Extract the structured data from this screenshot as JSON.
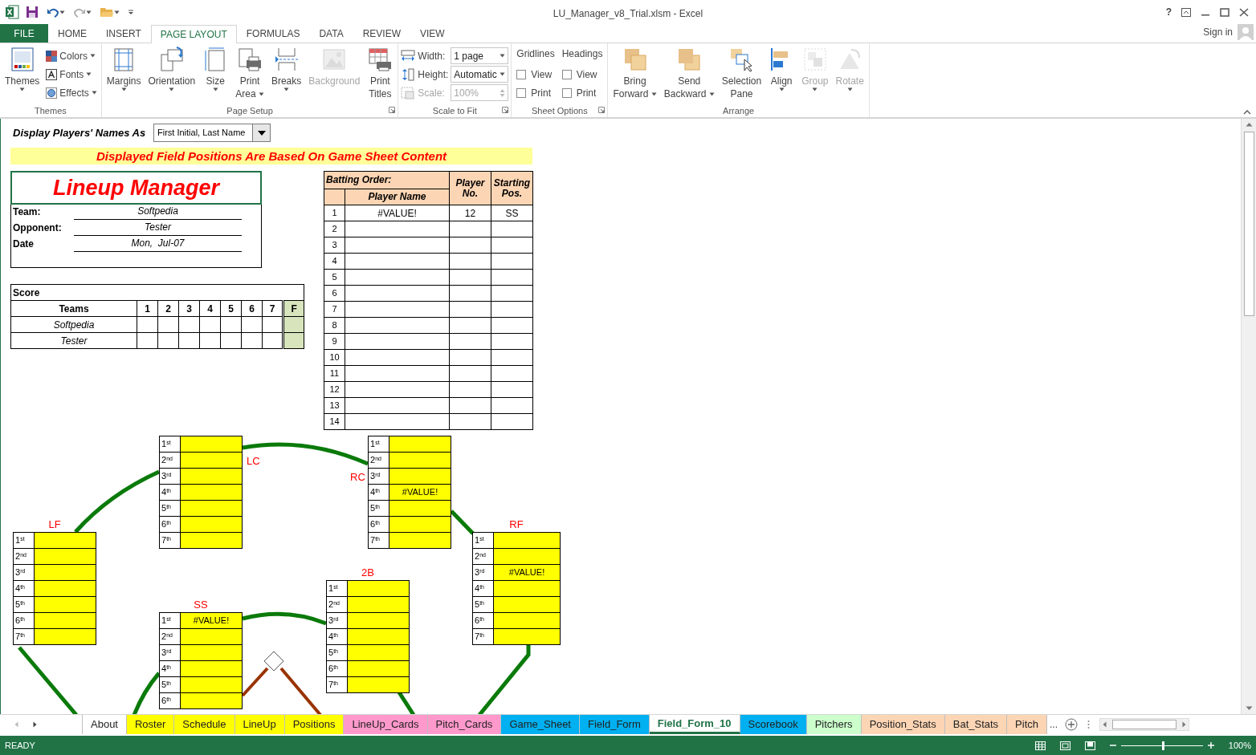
{
  "title_bar": {
    "title": "LU_Manager_v8_Trial.xlsm - Excel",
    "help": "?"
  },
  "ribbon_tabs": [
    {
      "label": "FILE",
      "kind": "file",
      "selected": false
    },
    {
      "label": "HOME",
      "kind": "tab",
      "selected": false
    },
    {
      "label": "INSERT",
      "kind": "tab",
      "selected": false
    },
    {
      "label": "PAGE LAYOUT",
      "kind": "tab",
      "selected": true
    },
    {
      "label": "FORMULAS",
      "kind": "tab",
      "selected": false
    },
    {
      "label": "DATA",
      "kind": "tab",
      "selected": false
    },
    {
      "label": "REVIEW",
      "kind": "tab",
      "selected": false
    },
    {
      "label": "VIEW",
      "kind": "tab",
      "selected": false
    }
  ],
  "account": {
    "label": "Sign in"
  },
  "ribbon_groups": [
    {
      "title": "Themes",
      "launcher": false,
      "items": [
        {
          "kind": "large",
          "lines": [
            "Themes"
          ],
          "dropdown": true,
          "disabled": false
        },
        {
          "kind": "small",
          "label": "Colors",
          "dropdown": true,
          "disabled": false
        },
        {
          "kind": "small",
          "label": "Fonts",
          "dropdown": true,
          "disabled": false
        },
        {
          "kind": "small",
          "label": "Effects",
          "dropdown": true,
          "disabled": false
        }
      ]
    },
    {
      "title": "Page Setup",
      "launcher": true,
      "items": [
        {
          "kind": "large",
          "lines": [
            "Margins"
          ],
          "dropdown": true,
          "disabled": false
        },
        {
          "kind": "large",
          "lines": [
            "Orientation"
          ],
          "dropdown": true,
          "disabled": false
        },
        {
          "kind": "large",
          "lines": [
            "Size"
          ],
          "dropdown": true,
          "disabled": false
        },
        {
          "kind": "large",
          "lines": [
            "Print",
            "Area"
          ],
          "dropdown": true,
          "disabled": false
        },
        {
          "kind": "large",
          "lines": [
            "Breaks"
          ],
          "dropdown": true,
          "disabled": false
        },
        {
          "kind": "large",
          "lines": [
            "Background"
          ],
          "dropdown": false,
          "disabled": true
        },
        {
          "kind": "large",
          "lines": [
            "Print",
            "Titles"
          ],
          "dropdown": false,
          "disabled": false
        }
      ]
    },
    {
      "title": "Scale to Fit",
      "launcher": true,
      "items": [
        {
          "kind": "field",
          "label": "Width:",
          "value": "1 page",
          "disabled": false
        },
        {
          "kind": "field",
          "label": "Height:",
          "value": "Automatic",
          "disabled": false
        },
        {
          "kind": "spin",
          "label": "Scale:",
          "value": "100%",
          "disabled": true
        }
      ]
    },
    {
      "title": "Sheet Options",
      "launcher": true,
      "items": [
        {
          "kind": "checks",
          "heading": "Gridlines",
          "options": [
            {
              "label": "View",
              "checked": false
            },
            {
              "label": "Print",
              "checked": false
            }
          ]
        },
        {
          "kind": "checks",
          "heading": "Headings",
          "options": [
            {
              "label": "View",
              "checked": false
            },
            {
              "label": "Print",
              "checked": false
            }
          ]
        }
      ]
    },
    {
      "title": "Arrange",
      "launcher": false,
      "items": [
        {
          "kind": "large",
          "lines": [
            "Bring",
            "Forward"
          ],
          "dropdown": true,
          "disabled": false
        },
        {
          "kind": "large",
          "lines": [
            "Send",
            "Backward"
          ],
          "dropdown": true,
          "disabled": false
        },
        {
          "kind": "large",
          "lines": [
            "Selection",
            "Pane"
          ],
          "dropdown": false,
          "disabled": false
        },
        {
          "kind": "large",
          "lines": [
            "Align"
          ],
          "dropdown": true,
          "disabled": false
        },
        {
          "kind": "large",
          "lines": [
            "Group"
          ],
          "dropdown": true,
          "disabled": true
        },
        {
          "kind": "large",
          "lines": [
            "Rotate"
          ],
          "dropdown": true,
          "disabled": true
        }
      ]
    }
  ],
  "names_as": {
    "label": "Display Players' Names As",
    "value": "First Initial, Last Name"
  },
  "banner": "Displayed Field Positions Are Based On Game Sheet Content",
  "lineup": {
    "title": "Lineup Manager",
    "fields": [
      {
        "label": "Team:",
        "value": "Softpedia"
      },
      {
        "label": "Opponent:",
        "value": "Tester"
      },
      {
        "label": "Date",
        "value": "Mon,  Jul-07"
      }
    ]
  },
  "score": {
    "title": "Score",
    "columns": [
      "Teams",
      "1",
      "2",
      "3",
      "4",
      "5",
      "6",
      "7",
      "F"
    ],
    "rows": [
      {
        "team": "Softpedia"
      },
      {
        "team": "Tester"
      }
    ]
  },
  "batting": {
    "group": "Batting Order:",
    "name": "Player Name",
    "number": "Player No.",
    "position": "Starting Pos.",
    "rows": [
      {
        "order": "1",
        "name": "#VALUE!",
        "number": "12",
        "position": "SS"
      },
      {
        "order": "2"
      },
      {
        "order": "3"
      },
      {
        "order": "4"
      },
      {
        "order": "5"
      },
      {
        "order": "6"
      },
      {
        "order": "7"
      },
      {
        "order": "8"
      },
      {
        "order": "9"
      },
      {
        "order": "10"
      },
      {
        "order": "11"
      },
      {
        "order": "12"
      },
      {
        "order": "13"
      },
      {
        "order": "14"
      }
    ]
  },
  "positions": [
    {
      "label": "LC",
      "rows": [
        {
          "ordinal": "1$^{st}$"
        },
        {
          "ordinal": "2$^{nd}$"
        },
        {
          "ordinal": "3$^{rd}$"
        },
        {
          "ordinal": "4$^{th}$"
        },
        {
          "ordinal": "5$^{th}$"
        },
        {
          "ordinal": "6$^{th}$"
        },
        {
          "ordinal": "7$^{th}$"
        }
      ]
    },
    {
      "label": "RC",
      "rows": [
        {
          "ordinal": "1$^{st}$"
        },
        {
          "ordinal": "2$^{nd}$"
        },
        {
          "ordinal": "3$^{rd}$"
        },
        {
          "ordinal": "4$^{th}$",
          "value": "#VALUE!"
        },
        {
          "ordinal": "5$^{th}$"
        },
        {
          "ordinal": "6$^{th}$"
        },
        {
          "ordinal": "7$^{th}$"
        }
      ]
    },
    {
      "label": "LF",
      "rows": [
        {
          "ordinal": "1$^{st}$"
        },
        {
          "ordinal": "2$^{nd}$"
        },
        {
          "ordinal": "3$^{rd}$"
        },
        {
          "ordinal": "4$^{th}$"
        },
        {
          "ordinal": "5$^{th}$"
        },
        {
          "ordinal": "6$^{th}$"
        },
        {
          "ordinal": "7$^{th}$"
        }
      ]
    },
    {
      "label": "RF",
      "rows": [
        {
          "ordinal": "1$^{st}$"
        },
        {
          "ordinal": "2$^{nd}$"
        },
        {
          "ordinal": "3$^{rd}$",
          "value": "#VALUE!"
        },
        {
          "ordinal": "4$^{th}$"
        },
        {
          "ordinal": "5$^{th}$"
        },
        {
          "ordinal": "6$^{th}$"
        },
        {
          "ordinal": "7$^{th}$"
        }
      ]
    },
    {
      "label": "2B",
      "rows": [
        {
          "ordinal": "1$^{st}$"
        },
        {
          "ordinal": "2$^{nd}$"
        },
        {
          "ordinal": "3$^{rd}$"
        },
        {
          "ordinal": "4$^{th}$"
        },
        {
          "ordinal": "5$^{th}$"
        },
        {
          "ordinal": "6$^{th}$"
        },
        {
          "ordinal": "7$^{th}$"
        }
      ]
    },
    {
      "label": "SS",
      "rows": [
        {
          "ordinal": "1$^{st}$",
          "value": "#VALUE!"
        },
        {
          "ordinal": "2$^{nd}$"
        },
        {
          "ordinal": "3$^{rd}$"
        },
        {
          "ordinal": "4$^{th}$"
        },
        {
          "ordinal": "5$^{th}$"
        },
        {
          "ordinal": "6$^{th}$"
        }
      ]
    }
  ],
  "sheet_tabs": [
    {
      "label": "About",
      "selected": false
    },
    {
      "label": "Roster",
      "selected": false,
      "color": "#ffff00"
    },
    {
      "label": "Schedule",
      "selected": false,
      "color": "#ffff00"
    },
    {
      "label": "LineUp",
      "selected": false,
      "color": "#ffff00"
    },
    {
      "label": "Positions",
      "selected": false,
      "color": "#ffff00"
    },
    {
      "label": "LineUp_Cards",
      "selected": false,
      "color": "#ff99cc"
    },
    {
      "label": "Pitch_Cards",
      "selected": false,
      "color": "#ff99cc"
    },
    {
      "label": "Game_Sheet",
      "selected": false,
      "color": "#00b0f0"
    },
    {
      "label": "Field_Form",
      "selected": false,
      "color": "#00b0f0"
    },
    {
      "label": "Field_Form_10",
      "selected": true
    },
    {
      "label": "Scorebook",
      "selected": false,
      "color": "#00b0f0"
    },
    {
      "label": "Pitchers",
      "selected": false,
      "color": "#ccffcc"
    },
    {
      "label": "Position_Stats",
      "selected": false,
      "color": "#fcd5b4"
    },
    {
      "label": "Bat_Stats",
      "selected": false,
      "color": "#fcd5b4"
    },
    {
      "label": "Pitch",
      "selected": false,
      "color": "#fcd5b4"
    }
  ],
  "more_tabs": "...",
  "status_bar": {
    "mode": "READY",
    "zoom": "100%",
    "zoom_slider": {
      "level": 0.5
    }
  }
}
